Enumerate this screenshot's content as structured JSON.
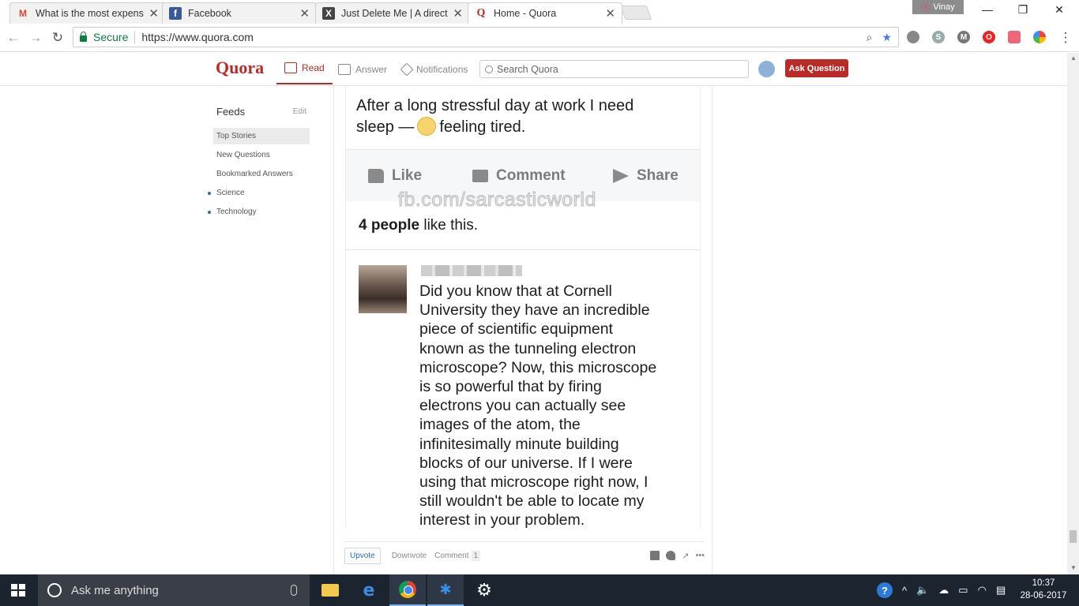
{
  "browser": {
    "tabs": [
      {
        "title": "What is the most expensi",
        "favicon": "gmail-icon",
        "active": false
      },
      {
        "title": "Facebook",
        "favicon": "facebook-icon",
        "active": false
      },
      {
        "title": "Just Delete Me | A directo",
        "favicon": "justdeleteme-icon",
        "active": false
      },
      {
        "title": "Home - Quora",
        "favicon": "quora-icon",
        "active": true
      }
    ],
    "profile_name": "Vinay",
    "secure_label": "Secure",
    "url": "https://www.quora.com"
  },
  "quora": {
    "logo": "Quora",
    "nav": {
      "read": "Read",
      "answer": "Answer",
      "notifications": "Notifications"
    },
    "search_placeholder": "Search Quora",
    "ask_button": "Ask Question",
    "brand_color": "#b92b27"
  },
  "sidebar": {
    "title": "Feeds",
    "edit": "Edit",
    "items": [
      {
        "label": "Top Stories"
      },
      {
        "label": "New Questions"
      },
      {
        "label": "Bookmarked Answers"
      },
      {
        "label": "Science"
      },
      {
        "label": "Technology"
      }
    ]
  },
  "post_image": {
    "status_line1": "After a long stressful day at work I need",
    "status_line2_a": "sleep —",
    "status_line2_b": "feeling tired.",
    "actions": {
      "like": "Like",
      "comment": "Comment",
      "share": "Share"
    },
    "watermark": "fb.com/sarcasticworld",
    "likes_bold": "4 people",
    "likes_rest": "like this.",
    "comment_lines": [
      "Did you know that at Cornell",
      "University they have an incredible",
      "piece of scientific equipment",
      "known as the tunneling electron",
      "microscope? Now, this microscope",
      "is so powerful that by firing",
      "electrons you can actually see",
      "images of the atom, the",
      "infinitesimally minute building",
      "blocks of our universe. If I were",
      "using that microscope right now, I",
      "still wouldn't be able to locate my",
      "interest in your problem."
    ]
  },
  "votebar": {
    "upvote": "Upvote",
    "downvote": "Downvote",
    "comment": "Comment",
    "comment_count": "1",
    "more": "•••"
  },
  "taskbar": {
    "search_placeholder": "Ask me anything",
    "time": "10:37",
    "date": "28-06-2017"
  }
}
